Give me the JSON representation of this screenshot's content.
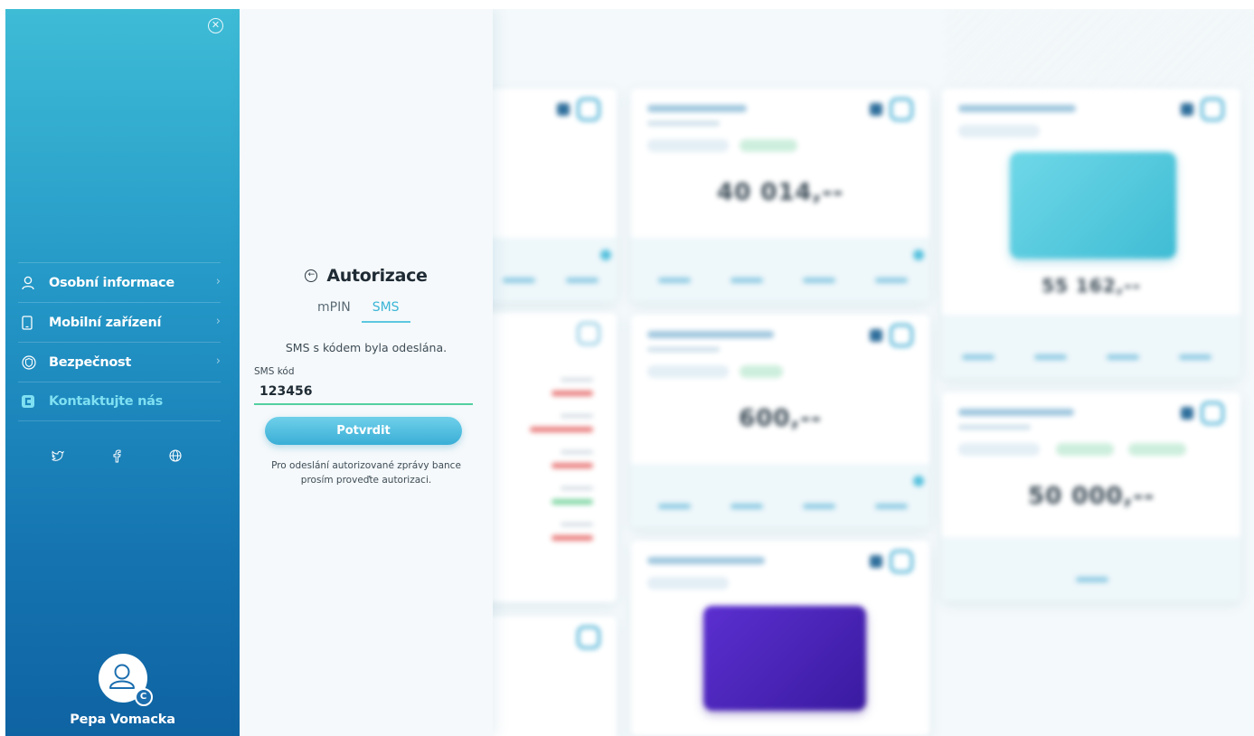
{
  "sidebar": {
    "menu": [
      {
        "label": "Osobní informace",
        "icon": "user-icon"
      },
      {
        "label": "Mobilní zařízení",
        "icon": "phone-icon"
      },
      {
        "label": "Bezpečnost",
        "icon": "shield-icon"
      },
      {
        "label": "Kontaktujte nás",
        "icon": "contact-logo-icon"
      }
    ],
    "social": [
      "twitter-icon",
      "facebook-icon",
      "globe-icon"
    ],
    "user_name": "Pepa Vomacka"
  },
  "auth": {
    "title": "Autorizace",
    "tabs": [
      {
        "label": "mPIN",
        "active": false
      },
      {
        "label": "SMS",
        "active": true
      }
    ],
    "sms_sent": "SMS s kódem byla odeslána.",
    "field_label": "SMS kód",
    "field_value": "123456",
    "confirm_label": "Potvrdit",
    "hint": "Pro odeslání autorizované zprávy bance prosím proveďte autorizaci."
  },
  "colors": {
    "sidebar_top": "#3ebcd6",
    "sidebar_bottom": "#0f63a2",
    "accent": "#3bb5d6",
    "field_underline": "#52d0a0",
    "contact_text": "#7fe0f2"
  }
}
